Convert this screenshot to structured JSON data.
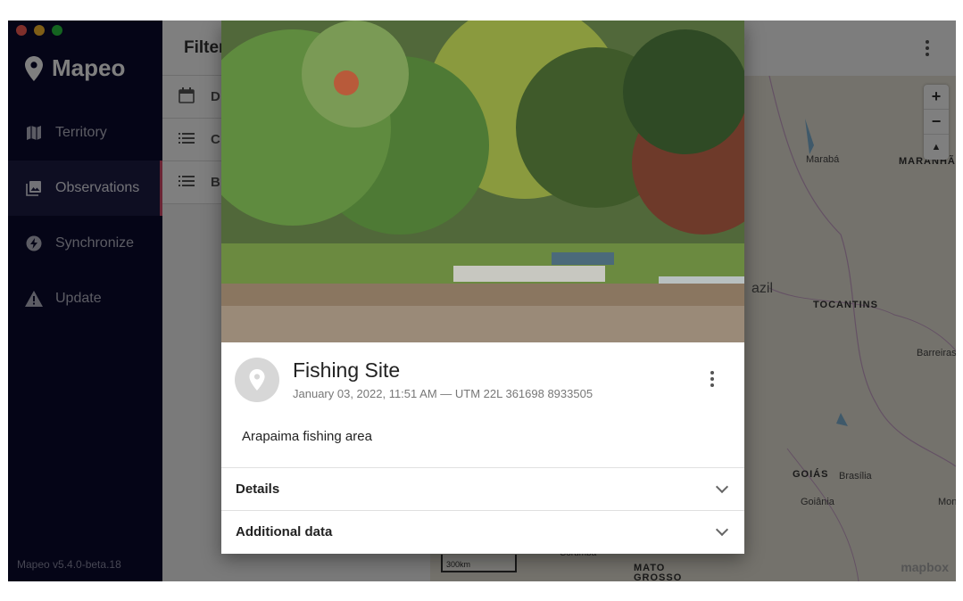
{
  "app": {
    "name": "Mapeo",
    "version": "Mapeo v5.4.0-beta.18"
  },
  "colors": {
    "sidebar_bg": "#0a0a2e",
    "active_accent": "#d64a6a",
    "close": "#ff5f57",
    "minimize": "#febc2e",
    "zoom": "#28c840"
  },
  "sidebar": {
    "items": [
      {
        "label": "Territory",
        "icon": "map-icon"
      },
      {
        "label": "Observations",
        "icon": "photo-library-icon",
        "active": true
      },
      {
        "label": "Synchronize",
        "icon": "sync-bolt-icon"
      },
      {
        "label": "Update",
        "icon": "warning-icon"
      }
    ]
  },
  "list_panel": {
    "filter_title": "Filter",
    "rows": [
      {
        "icon": "calendar-icon",
        "label": "D"
      },
      {
        "icon": "list-icon",
        "label": "C"
      },
      {
        "icon": "list-icon",
        "label": "B"
      }
    ]
  },
  "map": {
    "labels": [
      "Marabá",
      "MARANHÃO",
      "azil",
      "TOCANTINS",
      "Barreiras",
      "GOIÁS",
      "Brasília",
      "Goiânia",
      "Monte",
      "MATO GROSSO",
      "Corumbá"
    ],
    "zoom_in": "+",
    "zoom_out": "−",
    "compass": "▲",
    "scale": "300km",
    "attribution": "mapbox"
  },
  "modal": {
    "title": "Fishing Site",
    "subtitle": "January 03, 2022, 11:51 AM — UTM 22L 361698 8933505",
    "description": "Arapaima fishing area",
    "sections": [
      {
        "label": "Details"
      },
      {
        "label": "Additional data"
      }
    ]
  }
}
